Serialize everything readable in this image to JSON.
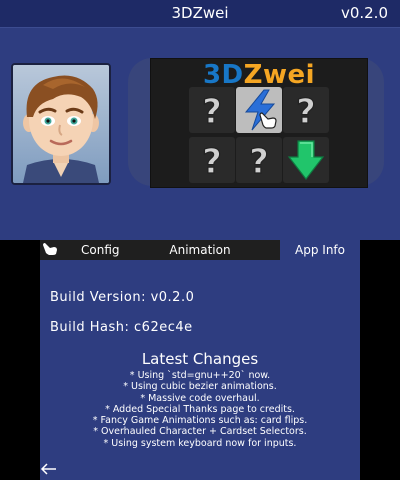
{
  "top": {
    "title": "3DZwei",
    "version": "v0.2.0",
    "logo": {
      "part1": "3D",
      "part2": "Zwei"
    },
    "cards": [
      {
        "face": "?",
        "icon": "question-mark"
      },
      {
        "face": "",
        "icon": "lightning-icon"
      },
      {
        "face": "?",
        "icon": "question-mark"
      },
      {
        "face": "?",
        "icon": "question-mark"
      },
      {
        "face": "?",
        "icon": "question-mark"
      },
      {
        "face": "",
        "icon": "arrow-down-icon"
      }
    ],
    "colors": {
      "logo_3d": "#1877c7",
      "logo_zwei": "#f5a623",
      "accent_green": "#21c56b"
    }
  },
  "bottom": {
    "tabs": [
      {
        "label": "Config",
        "active": false
      },
      {
        "label": "Animation",
        "active": false
      },
      {
        "label": "App Info",
        "active": true
      }
    ],
    "build_version": "Build Version: v0.2.0",
    "build_hash": "Build Hash: c62ec4e",
    "changes_title": "Latest Changes",
    "changes": [
      "* Using `std=gnu++20` now.",
      "* Using cubic bezier animations.",
      "* Massive code overhaul.",
      "* Added Special Thanks page to credits.",
      "* Fancy Game Animations such as: card flips.",
      "* Overhauled Character + Cardset Selectors.",
      "* Using system keyboard now for inputs."
    ]
  }
}
